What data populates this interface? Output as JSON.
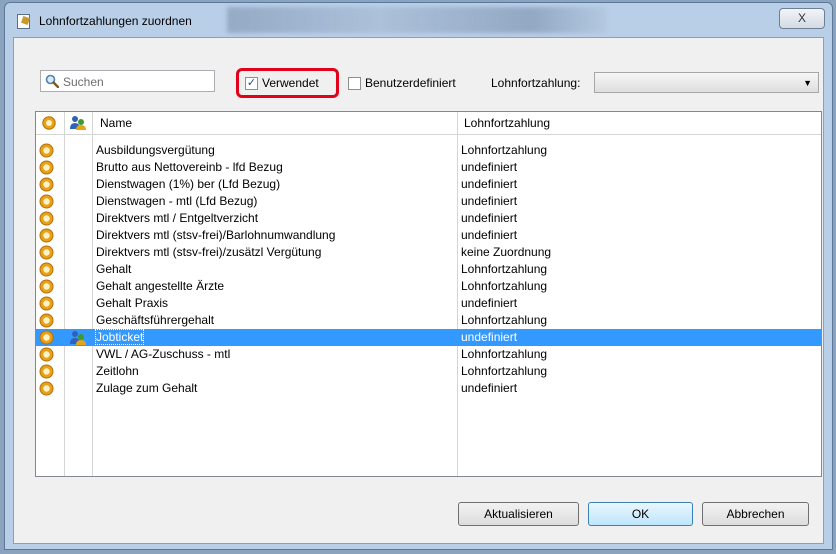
{
  "window": {
    "title": "Lohnfortzahlungen zuordnen",
    "close_label": "X"
  },
  "toolbar": {
    "search_placeholder": "Suchen",
    "verwendet_label": "Verwendet",
    "verwendet_checked": true,
    "benutzerdefiniert_label": "Benutzerdefiniert",
    "benutzerdefiniert_checked": false,
    "lohnfortzahlung_label": "Lohnfortzahlung:",
    "lohnfortzahlung_value": ""
  },
  "table": {
    "columns": [
      "Name",
      "Lohnfortzahlung"
    ],
    "rows": [
      {
        "name": "Ausbildungsvergütung",
        "lfz": "Lohnfortzahlung",
        "person": false,
        "selected": false
      },
      {
        "name": "Brutto aus Nettovereinb - lfd Bezug",
        "lfz": "undefiniert",
        "person": false,
        "selected": false
      },
      {
        "name": "Dienstwagen (1%) ber (Lfd Bezug)",
        "lfz": "undefiniert",
        "person": false,
        "selected": false
      },
      {
        "name": "Dienstwagen - mtl (Lfd Bezug)",
        "lfz": "undefiniert",
        "person": false,
        "selected": false
      },
      {
        "name": "Direktvers mtl / Entgeltverzicht",
        "lfz": "undefiniert",
        "person": false,
        "selected": false
      },
      {
        "name": "Direktvers mtl (stsv-frei)/Barlohnumwandlung",
        "lfz": "undefiniert",
        "person": false,
        "selected": false
      },
      {
        "name": "Direktvers mtl (stsv-frei)/zusätzl Vergütung",
        "lfz": "keine Zuordnung",
        "person": false,
        "selected": false
      },
      {
        "name": "Gehalt",
        "lfz": "Lohnfortzahlung",
        "person": false,
        "selected": false
      },
      {
        "name": "Gehalt angestellte Ärzte",
        "lfz": "Lohnfortzahlung",
        "person": false,
        "selected": false
      },
      {
        "name": "Gehalt Praxis",
        "lfz": "undefiniert",
        "person": false,
        "selected": false
      },
      {
        "name": "Geschäftsführergehalt",
        "lfz": "Lohnfortzahlung",
        "person": false,
        "selected": false
      },
      {
        "name": "Jobticket",
        "lfz": "undefiniert",
        "person": true,
        "selected": true
      },
      {
        "name": "VWL / AG-Zuschuss - mtl",
        "lfz": "Lohnfortzahlung",
        "person": false,
        "selected": false
      },
      {
        "name": "Zeitlohn",
        "lfz": "Lohnfortzahlung",
        "person": false,
        "selected": false
      },
      {
        "name": "Zulage zum Gehalt",
        "lfz": "undefiniert",
        "person": false,
        "selected": false
      }
    ]
  },
  "buttons": {
    "refresh_label": "Aktualisieren",
    "ok_label": "OK",
    "cancel_label": "Abbrechen"
  },
  "colors": {
    "selection": "#3399ff",
    "highlight_frame": "#e3001b",
    "coin": "#e8a21a"
  },
  "icons": {
    "coin": "coin-icon",
    "person": "person-icon",
    "search": "magnifier-icon",
    "dropdown": "chevron-down-icon"
  }
}
